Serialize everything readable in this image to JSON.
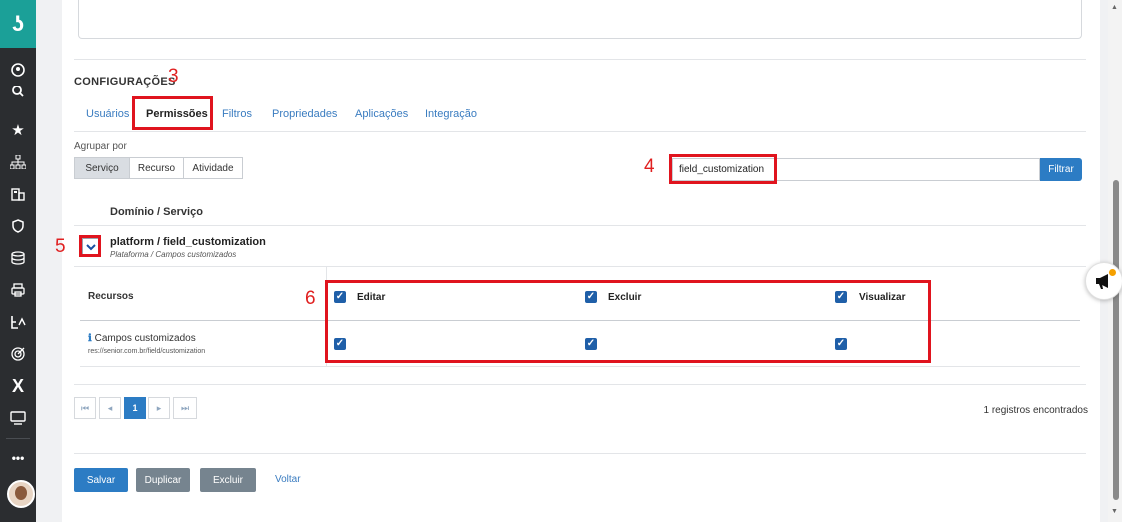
{
  "sidebar": {
    "brand_glyph": "ʖ",
    "icons": [
      "user-icon",
      "search-icon",
      "star-icon",
      "org-chart-icon",
      "building-icon",
      "shield-icon",
      "database-icon",
      "printer-icon",
      "user-tag-icon",
      "target-icon",
      "close-x-icon",
      "monitor-icon",
      "more-icon"
    ]
  },
  "section": {
    "title": "CONFIGURAÇÕES",
    "tabs": [
      "Usuários",
      "Permissões",
      "Filtros",
      "Propriedades",
      "Aplicações",
      "Integração"
    ],
    "active_tab": "Permissões"
  },
  "annotations": {
    "n3": "3",
    "n4": "4",
    "n5": "5",
    "n6": "6"
  },
  "group": {
    "label": "Agrupar por",
    "options": [
      "Serviço",
      "Recurso",
      "Atividade"
    ],
    "selected": "Serviço"
  },
  "filter": {
    "value": "field_customization",
    "button": "Filtrar"
  },
  "table": {
    "column_header": "Domínio / Serviço",
    "row_title": "platform / field_customization",
    "row_subtitle": "Plataforma / Campos customizados",
    "resources_header": "Recursos",
    "permissions": [
      "Editar",
      "Excluir",
      "Visualizar"
    ],
    "resource_name": "Campos customizados",
    "resource_path": "res://senior.com.br/field/customization",
    "checked": [
      true,
      true,
      true
    ]
  },
  "pager": {
    "first": "⏮",
    "prev": "◂",
    "current": "1",
    "next": "▸",
    "last": "⏭",
    "records": "1 registros encontrados"
  },
  "actions": {
    "save": "Salvar",
    "duplicate": "Duplicar",
    "delete": "Excluir",
    "back": "Voltar"
  },
  "colors": {
    "accent": "#2c7cc4",
    "brand": "#1ba098",
    "annotation": "#e0141e"
  }
}
